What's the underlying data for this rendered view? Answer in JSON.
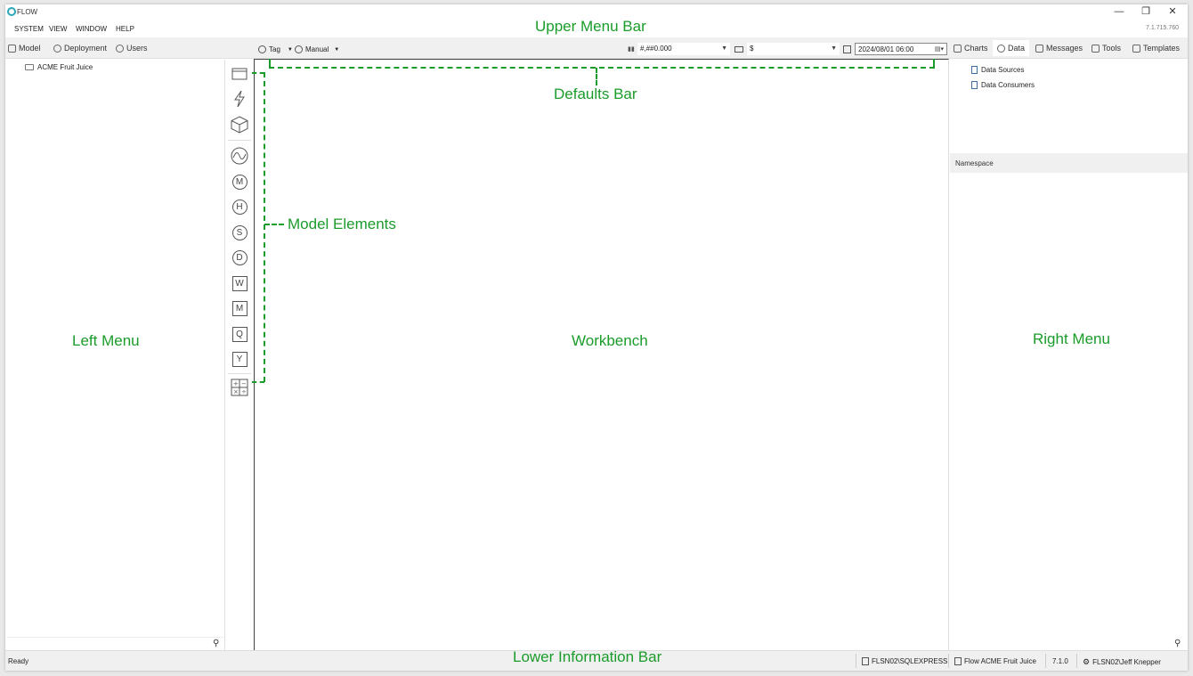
{
  "window": {
    "app_title": "FLOW",
    "version": "7.1.715.760",
    "controls": [
      "—",
      "❐",
      "✕"
    ]
  },
  "menu": [
    "SYSTEM",
    "VIEW",
    "WINDOW",
    "HELP"
  ],
  "left_tabs": [
    "Model",
    "Deployment",
    "Users"
  ],
  "defaults_bar": {
    "tag_label": "Tag",
    "manual_label": "Manual",
    "number_format": "#,##0.000",
    "currency": "$",
    "date": "2024/08/01 06:00"
  },
  "right_tabs": [
    "Charts",
    "Data",
    "Messages",
    "Tools",
    "Templates"
  ],
  "right_tabs_active": "Data",
  "left_tree": [
    "ACME Fruit Juice"
  ],
  "toolbox": {
    "icons": [
      "folder-icon",
      "lightning-icon",
      "cube-icon",
      "wave-icon",
      "m-circle-icon",
      "h-circle-icon",
      "s-circle-icon",
      "d-circle-icon",
      "w-square-icon",
      "m-square-icon",
      "q-square-icon",
      "y-square-icon",
      "calculator-icon"
    ],
    "letters": [
      "M",
      "H",
      "S",
      "D",
      "W",
      "M",
      "Q",
      "Y"
    ]
  },
  "right_tree": [
    "Data Sources",
    "Data Consumers"
  ],
  "namespace_label": "Namespace",
  "status": {
    "ready": "Ready",
    "server": "FLSN02\\SQLEXPRESS",
    "model": "Flow ACME Fruit Juice",
    "version": "7.1.0",
    "user": "FLSN02\\Jeff Knepper"
  },
  "annotations": {
    "upper_menu_bar": "Upper Menu Bar",
    "defaults_bar": "Defaults Bar",
    "model_elements": "Model Elements",
    "left_menu": "Left Menu",
    "workbench": "Workbench",
    "right_menu": "Right Menu",
    "lower_information_bar": "Lower Information Bar"
  },
  "accent_color": "#1a9c2a"
}
